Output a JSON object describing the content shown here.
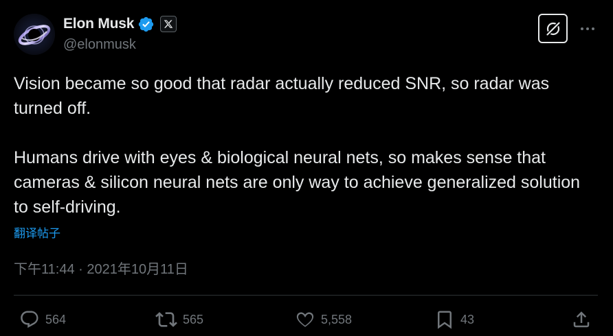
{
  "author": {
    "display_name": "Elon Musk",
    "handle": "@elonmusk",
    "verified": true,
    "affiliation_badge": "X"
  },
  "tweet": {
    "paragraph_1": "Vision became so good that radar actually reduced SNR, so radar was turned off.",
    "paragraph_2": "Humans drive with eyes & biological neural nets, so makes sense that cameras & silicon neural nets are only way to achieve generalized solution to self-driving.",
    "translate_label": "翻译帖子",
    "timestamp": "下午11:44 · 2021年10月11日"
  },
  "actions": {
    "replies": "564",
    "reposts": "565",
    "likes": "5,558",
    "bookmarks": "43"
  },
  "icons": {
    "header_right": [
      "grok-icon",
      "more-icon"
    ],
    "action_bar": [
      "reply-icon",
      "repost-icon",
      "like-icon",
      "bookmark-icon",
      "share-icon"
    ]
  },
  "colors": {
    "background": "#000000",
    "text_primary": "#e7e9ea",
    "text_secondary": "#71767b",
    "link": "#1d9bf0",
    "verified": "#1d9bf0",
    "divider": "#2f3336"
  }
}
